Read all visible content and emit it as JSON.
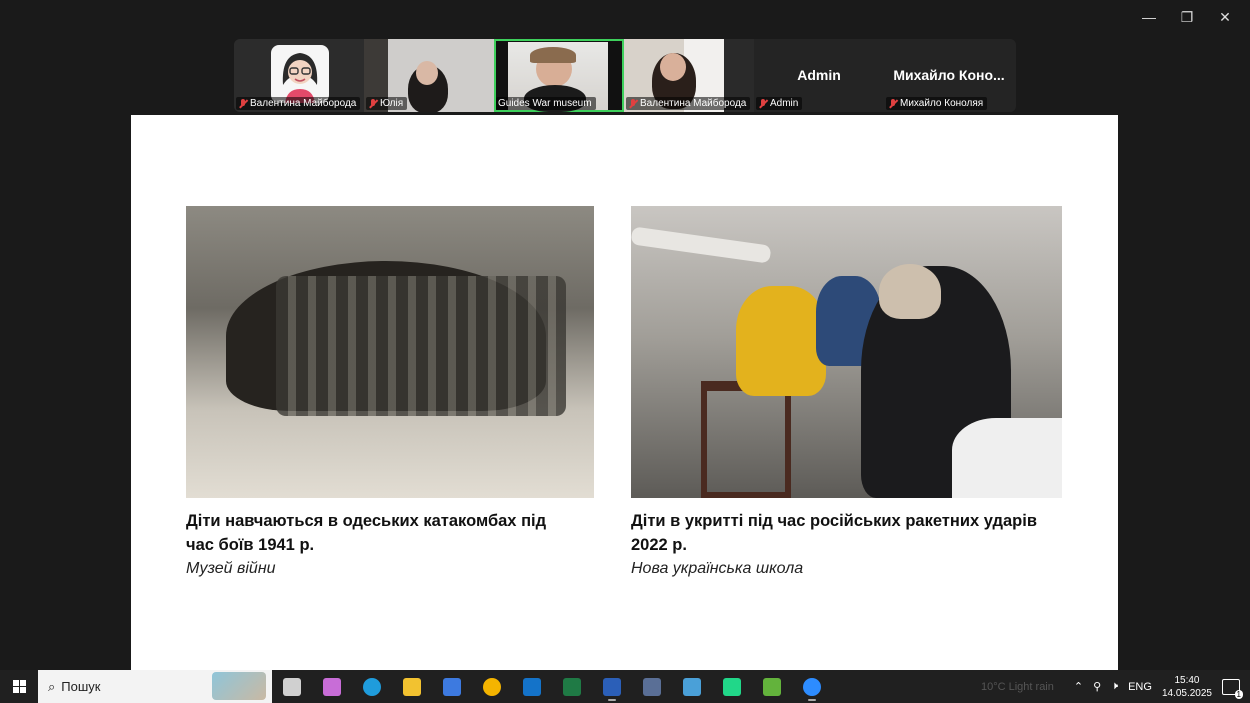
{
  "window": {
    "minimize": "—",
    "restore": "❐",
    "close": "✕"
  },
  "participants": [
    {
      "name": "Валентина Майборода",
      "muted": true
    },
    {
      "name": "Юлія",
      "muted": true
    },
    {
      "name": "Guides War museum",
      "muted": false,
      "speaking": true
    },
    {
      "name": "Валентина Майборода",
      "muted": true
    },
    {
      "name": "Admin",
      "display": "Admin",
      "muted": true
    },
    {
      "name": "Михайло Коноляя",
      "display": "Михайло Коно...",
      "muted": true
    }
  ],
  "slide": {
    "left": {
      "title_line1": "Діти навчаються в одеських катакомбах під",
      "title_line2": "час боїв 1941 р.",
      "source": "Музей війни"
    },
    "right": {
      "title_line1": "Діти в укритті під час російських ракетних ударів",
      "title_line2": "2022 р.",
      "source": "Нова українська школа"
    }
  },
  "taskbar": {
    "search_placeholder": "Пошук",
    "apps": [
      {
        "name": "task-view",
        "color": "#d0d0d0"
      },
      {
        "name": "copilot",
        "color": "#c86dd7"
      },
      {
        "name": "edge",
        "color": "#1f9cdc"
      },
      {
        "name": "file-explorer",
        "color": "#f2c230"
      },
      {
        "name": "store",
        "color": "#3d7ae0"
      },
      {
        "name": "chrome",
        "color": "#f4b400"
      },
      {
        "name": "outlook",
        "color": "#1473c9"
      },
      {
        "name": "excel",
        "color": "#1f7a45"
      },
      {
        "name": "word",
        "color": "#2b5fb8"
      },
      {
        "name": "calculator",
        "color": "#5a6f96"
      },
      {
        "name": "notes",
        "color": "#4aa0d8"
      },
      {
        "name": "pycharm",
        "color": "#21d789"
      },
      {
        "name": "minecraft",
        "color": "#63b33c"
      },
      {
        "name": "zoom",
        "color": "#2d8cff"
      }
    ],
    "weather": "10°C Light rain",
    "language": "ENG",
    "time": "15:40",
    "date": "14.05.2025",
    "notifications": "1"
  }
}
